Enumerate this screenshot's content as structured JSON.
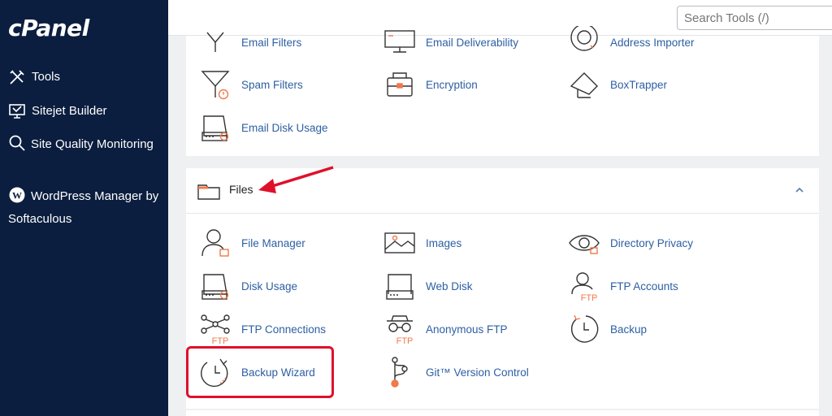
{
  "sidebar": {
    "logo": "cPanel",
    "items": [
      {
        "label": "Tools",
        "icon": "tools-icon"
      },
      {
        "label": "Sitejet Builder",
        "icon": "sitejet-icon"
      },
      {
        "label": "Site Quality Monitoring",
        "icon": "magnifier-icon"
      },
      {
        "label": "WordPress Manager by Softaculous",
        "icon": "wordpress-icon"
      }
    ]
  },
  "search": {
    "placeholder": "Search Tools (/)"
  },
  "email_section": {
    "items": [
      {
        "label": "Email Filters",
        "icon": "filter-icon"
      },
      {
        "label": "Email Deliverability",
        "icon": "monitor-icon"
      },
      {
        "label": "Address Importer",
        "icon": "importer-icon"
      },
      {
        "label": "Spam Filters",
        "icon": "spam-filter-icon"
      },
      {
        "label": "Encryption",
        "icon": "encryption-icon"
      },
      {
        "label": "BoxTrapper",
        "icon": "boxtrapper-icon"
      },
      {
        "label": "Email Disk Usage",
        "icon": "disk-usage-icon"
      }
    ]
  },
  "files_section": {
    "title": "Files",
    "items": [
      {
        "label": "File Manager",
        "icon": "file-manager-icon"
      },
      {
        "label": "Images",
        "icon": "images-icon"
      },
      {
        "label": "Directory Privacy",
        "icon": "eye-icon"
      },
      {
        "label": "Disk Usage",
        "icon": "disk-icon"
      },
      {
        "label": "Web Disk",
        "icon": "web-disk-icon"
      },
      {
        "label": "FTP Accounts",
        "icon": "ftp-accounts-icon"
      },
      {
        "label": "FTP Connections",
        "icon": "ftp-connections-icon"
      },
      {
        "label": "Anonymous FTP",
        "icon": "anonymous-ftp-icon"
      },
      {
        "label": "Backup",
        "icon": "backup-icon"
      },
      {
        "label": "Backup Wizard",
        "icon": "backup-wizard-icon"
      },
      {
        "label": "Git™ Version Control",
        "icon": "git-icon"
      }
    ],
    "icon_badge": "FTP"
  },
  "colors": {
    "sidebar": "#0b1e3f",
    "link": "#2d5fa3",
    "accent": "#f07a4a",
    "highlight": "#e0102a"
  }
}
